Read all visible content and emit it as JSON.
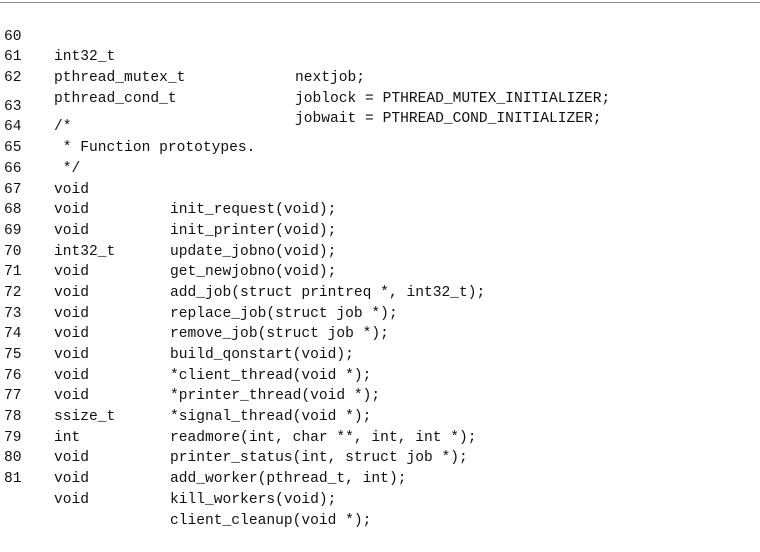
{
  "listing": {
    "block1": [
      {
        "ln": "60",
        "type": "int32_t",
        "name": "nextjob;"
      },
      {
        "ln": "61",
        "type": "pthread_mutex_t",
        "name": "joblock = PTHREAD_MUTEX_INITIALIZER;"
      },
      {
        "ln": "62",
        "type": "pthread_cond_t",
        "name": "jobwait = PTHREAD_COND_INITIALIZER;"
      }
    ],
    "comment": [
      {
        "ln": "63",
        "text": "/*"
      },
      {
        "ln": "64",
        "text": " * Function prototypes."
      },
      {
        "ln": "65",
        "text": " */"
      }
    ],
    "prototypes": [
      {
        "ln": "66",
        "type": "void",
        "decl": "init_request(void);"
      },
      {
        "ln": "67",
        "type": "void",
        "decl": "init_printer(void);"
      },
      {
        "ln": "68",
        "type": "void",
        "decl": "update_jobno(void);"
      },
      {
        "ln": "69",
        "type": "int32_t",
        "decl": "get_newjobno(void);"
      },
      {
        "ln": "70",
        "type": "void",
        "decl": "add_job(struct printreq *, int32_t);"
      },
      {
        "ln": "71",
        "type": "void",
        "decl": "replace_job(struct job *);"
      },
      {
        "ln": "72",
        "type": "void",
        "decl": "remove_job(struct job *);"
      },
      {
        "ln": "73",
        "type": "void",
        "decl": "build_qonstart(void);"
      },
      {
        "ln": "74",
        "type": "void",
        "decl": "*client_thread(void *);"
      },
      {
        "ln": "75",
        "type": "void",
        "decl": "*printer_thread(void *);"
      },
      {
        "ln": "76",
        "type": "void",
        "decl": "*signal_thread(void *);"
      },
      {
        "ln": "77",
        "type": "ssize_t",
        "decl": "readmore(int, char **, int, int *);"
      },
      {
        "ln": "78",
        "type": "int",
        "decl": "printer_status(int, struct job *);"
      },
      {
        "ln": "79",
        "type": "void",
        "decl": "add_worker(pthread_t, int);"
      },
      {
        "ln": "80",
        "type": "void",
        "decl": "kill_workers(void);"
      },
      {
        "ln": "81",
        "type": "void",
        "decl": "client_cleanup(void *);"
      }
    ]
  }
}
